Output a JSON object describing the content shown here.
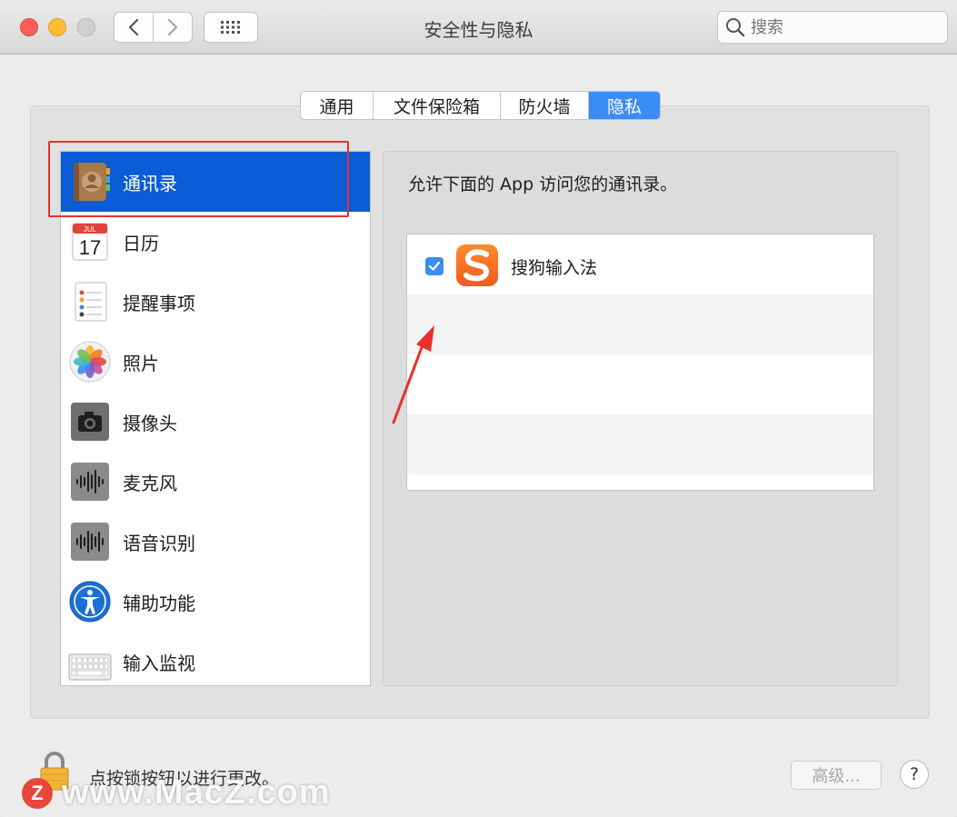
{
  "window": {
    "title": "安全性与隐私",
    "search_placeholder": "搜索"
  },
  "tabs": [
    {
      "label": "通用",
      "active": false
    },
    {
      "label": "文件保险箱",
      "active": false
    },
    {
      "label": "防火墙",
      "active": false
    },
    {
      "label": "隐私",
      "active": true
    }
  ],
  "sidebar": {
    "items": [
      {
        "label": "通讯录",
        "icon": "contacts-icon",
        "selected": true
      },
      {
        "label": "日历",
        "icon": "calendar-icon",
        "selected": false
      },
      {
        "label": "提醒事项",
        "icon": "reminders-icon",
        "selected": false
      },
      {
        "label": "照片",
        "icon": "photos-icon",
        "selected": false
      },
      {
        "label": "摄像头",
        "icon": "camera-icon",
        "selected": false
      },
      {
        "label": "麦克风",
        "icon": "microphone-icon",
        "selected": false
      },
      {
        "label": "语音识别",
        "icon": "speech-recognition-icon",
        "selected": false
      },
      {
        "label": "辅助功能",
        "icon": "accessibility-icon",
        "selected": false
      },
      {
        "label": "输入监视",
        "icon": "keyboard-icon",
        "selected": false
      }
    ],
    "calendar_month": "JUL",
    "calendar_day": "17"
  },
  "detail": {
    "description": "允许下面的 App 访问您的通讯录。",
    "apps": [
      {
        "name": "搜狗输入法",
        "checked": true,
        "icon": "sogou-icon"
      }
    ]
  },
  "footer": {
    "lock_text": "点按锁按钮以进行更改。",
    "advanced_label": "高级...",
    "help_label": "?"
  },
  "watermark": {
    "logo_letter": "Z",
    "text": "www.MacZ.com"
  },
  "colors": {
    "accent": "#3b8cf5",
    "selection": "#0a5dd6",
    "highlight_box": "#e8312a"
  }
}
